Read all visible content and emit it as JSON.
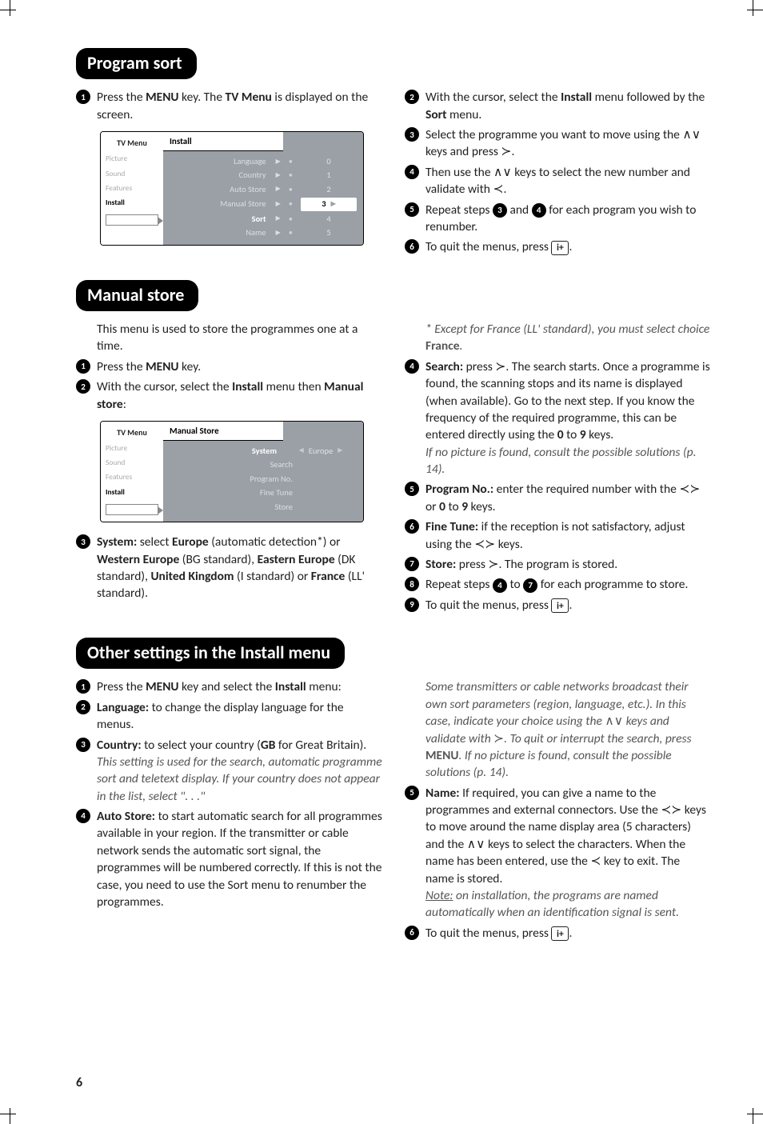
{
  "page_number": "6",
  "icons": {
    "info_key": "i+"
  },
  "sec1": {
    "title": "Program sort",
    "left": {
      "step1_a": "Press the ",
      "step1_menu": "MENU",
      "step1_b": " key. The ",
      "step1_tv": "TV Menu",
      "step1_c": " is displayed on the screen."
    },
    "menu": {
      "sidebar_title": "TV Menu",
      "sidebar_items": [
        "Picture",
        "Sound",
        "Features",
        "Install"
      ],
      "active_sidebar": 3,
      "header": "Install",
      "rows": [
        {
          "label": "Language",
          "val": "0"
        },
        {
          "label": "Country",
          "val": "1"
        },
        {
          "label": "Auto Store",
          "val": "2"
        },
        {
          "label": "Manual Store",
          "val": "3",
          "hl": true
        },
        {
          "label": "Sort",
          "val": "4",
          "lblsel": true
        },
        {
          "label": "Name",
          "val": "5"
        }
      ]
    },
    "right": {
      "s2a": "With the cursor, select the ",
      "s2b": "Install",
      "s2c": " menu followed by the ",
      "s2d": "Sort",
      "s2e": " menu.",
      "s3a": "Select the programme you want to move using the ",
      "s3b": " keys and press ",
      "s3c": ".",
      "s4a": "Then use the ",
      "s4b": " keys to select the new number and validate with ",
      "s4c": ".",
      "s5a": "Repeat steps ",
      "s5b": " and ",
      "s5c": " for each program you wish to renumber.",
      "s6a": "To quit the menus, press ",
      "s6b": "."
    }
  },
  "sec2": {
    "title": "Manual store",
    "left": {
      "intro": "This menu is used to store the programmes one at a time.",
      "s1a": "Press the ",
      "s1b": "MENU",
      "s1c": " key.",
      "s2a": "With the cursor, select the ",
      "s2b": "Install",
      "s2c": " menu then ",
      "s2d": "Manual store",
      "s2e": ":",
      "s3a": "System:",
      "s3b": " select ",
      "s3c": "Europe",
      "s3d": " (automatic detection*) or ",
      "s3e": "Western Europe",
      "s3f": " (BG standard), ",
      "s3g": "Eastern Europe",
      "s3h": " (DK standard), ",
      "s3i": "United Kingdom",
      "s3j": " (I standard) or ",
      "s3k": "France",
      "s3l": " (LL' standard)."
    },
    "menu": {
      "sidebar_title": "TV Menu",
      "sidebar_items": [
        "Picture",
        "Sound",
        "Features",
        "Install"
      ],
      "active_sidebar": 3,
      "header": "Manual Store",
      "rows": [
        {
          "label": "System",
          "val": "Europe",
          "lblsel": true,
          "valwide": true
        },
        {
          "label": "Search"
        },
        {
          "label": "Program No."
        },
        {
          "label": "Fine Tune"
        },
        {
          "label": "Store"
        }
      ]
    },
    "right": {
      "note": "* Except for France (LL' standard), you must select choice ",
      "note_b": "France",
      "note_c": ".",
      "s4a": "Search:",
      "s4b": " press ",
      "s4c": ". The search starts. Once a programme is found, the scanning stops and its name is displayed (when available). Go to the next step. If you know the frequency of the required programme, this can be entered directly using the ",
      "s4d": "0",
      "s4e": " to ",
      "s4f": "9",
      "s4g": " keys.",
      "s4n": "If no picture is found, consult the possible solutions (p. 14).",
      "s5a": "Program No.:",
      "s5b": " enter the required number with the ",
      "s5c": " or ",
      "s5d": "0",
      "s5e": " to ",
      "s5f": "9",
      "s5g": " keys.",
      "s6a": "Fine Tune:",
      "s6b": " if the reception is not satisfactory, adjust using the ",
      "s6c": " keys.",
      "s7a": "Store:",
      "s7b": " press ",
      "s7c": ". The program is stored.",
      "s8a": "Repeat steps ",
      "s8b": " to ",
      "s8c": " for each programme to store.",
      "s9a": "To quit the menus, press ",
      "s9b": "."
    }
  },
  "sec3": {
    "title": "Other settings in the Install menu",
    "left": {
      "s1a": "Press the ",
      "s1b": "MENU",
      "s1c": " key and select the ",
      "s1d": "Install",
      "s1e": " menu:",
      "s2a": "Language:",
      "s2b": " to change the display language for the menus.",
      "s3a": "Country:",
      "s3b": " to select your country (",
      "s3c": "GB",
      "s3d": " for Great Britain).",
      "s3n": "This setting is used for the search, automatic programme sort and teletext display. If your country does not appear in the list, select \". . .\"",
      "s4a": "Auto Store:",
      "s4b": " to start automatic search for all programmes available in your region. If the transmitter or cable network sends the automatic sort signal, the programmes will be numbered correctly. If this is not the case, you need to use the Sort menu to renumber the programmes."
    },
    "right": {
      "p4n_a": "Some transmitters or cable networks broadcast their own sort parameters (region, language, etc.). In this case, indicate your choice using the ",
      "p4n_b": " keys and validate with ",
      "p4n_c": ". To quit or interrupt the search, press ",
      "p4n_d": "MENU",
      "p4n_e": ". If no picture is found, consult the possible solutions (p. 14).",
      "s5a": "Name:",
      "s5b": " If required, you can give a name to the programmes and external connectors. Use the ",
      "s5c": " keys to move around the name display area (5 characters) and the ",
      "s5d": " keys to select the characters. When the name has been entered, use the ",
      "s5e": " key to exit. The name is stored.",
      "s5n_a": "Note:",
      "s5n_b": " on installation, the programs are named automatically when an identification signal is sent.",
      "s6a": "To quit the menus, press ",
      "s6b": "."
    }
  }
}
